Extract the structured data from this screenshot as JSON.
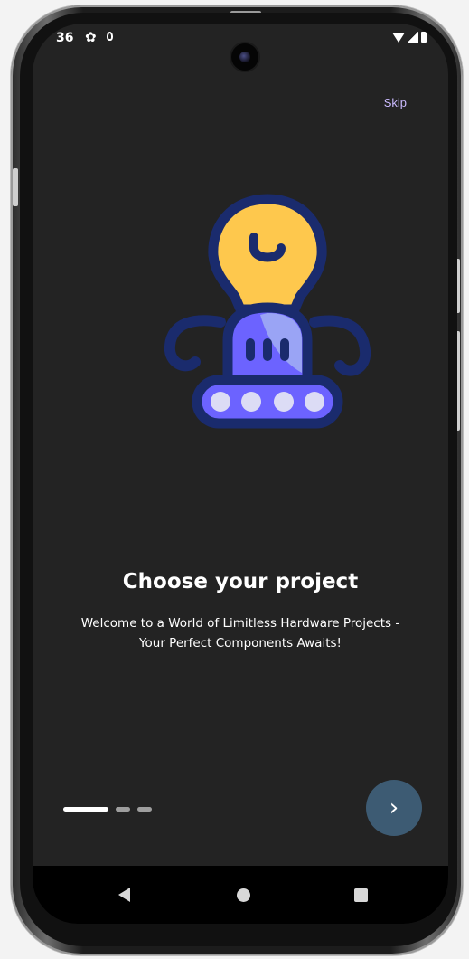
{
  "status_bar": {
    "time": "36",
    "settings_icon": "gear-icon",
    "notification_icon": "location-icon",
    "wifi_icon": "wifi-icon",
    "signal_icon": "signal-icon",
    "battery_icon": "battery-icon"
  },
  "header": {
    "skip_label": "Skip"
  },
  "illustration": {
    "icon": "robot-lightbulb-icon",
    "colors": {
      "bulb": "#fec84d",
      "outline": "#1a2b6d",
      "body": "#6c63ff",
      "body_highlight": "#9aa4f5",
      "wheels": "#dcdcf5"
    }
  },
  "content": {
    "title": "Choose your project",
    "subtitle_line1": "Welcome to a World of Limitless Hardware Projects -",
    "subtitle_line2": "Your Perfect Components Awaits!"
  },
  "pager": {
    "page_count": 3,
    "current_page": 1
  },
  "next_button": {
    "icon": "chevron-right-icon",
    "glyph": "›",
    "color": "#3d5b73"
  },
  "nav_bar": {
    "back_icon": "back-icon",
    "home_icon": "home-icon",
    "recents_icon": "recents-icon"
  },
  "colors": {
    "background": "#232323",
    "skip": "#cbbbff",
    "text": "#ffffff"
  }
}
